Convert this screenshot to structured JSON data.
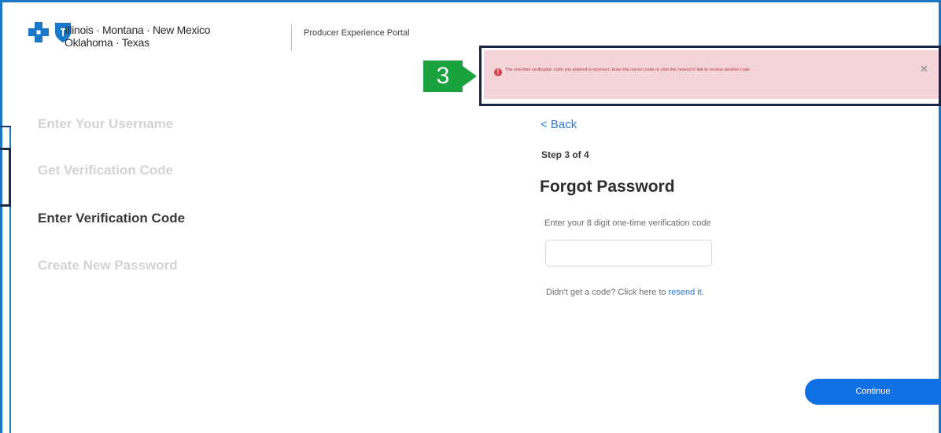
{
  "header": {
    "logo_line1": "Illinois · Montana · New Mexico",
    "logo_line2": "Oklahoma · Texas",
    "portal_name": "Producer Experience Portal"
  },
  "callout": {
    "number": "3"
  },
  "alert": {
    "message": "The one-time verification code you entered is incorrect. Enter the correct code or click the 'resend it' link to receive another code",
    "close_label": "✕"
  },
  "steps": [
    {
      "label": "Enter Your Username",
      "state": "inactive"
    },
    {
      "label": "Get Verification Code",
      "state": "inactive"
    },
    {
      "label": "Enter Verification Code",
      "state": "active"
    },
    {
      "label": "Create New Password",
      "state": "inactive"
    }
  ],
  "form": {
    "back_label": "< Back",
    "step_counter": "Step 3 of 4",
    "title": "Forgot Password",
    "code_label": "Enter your 8 digit one-time verification code",
    "code_value": "",
    "resend_prefix": "Didn't get a code? Click here to ",
    "resend_link": "resend it.",
    "continue_label": "Continue"
  },
  "colors": {
    "brand_blue": "#1b78c9",
    "button_blue": "#1170e4",
    "alert_bg": "#f4d4d8",
    "alert_text": "#b3303b",
    "callout_green": "#1aa23f"
  }
}
